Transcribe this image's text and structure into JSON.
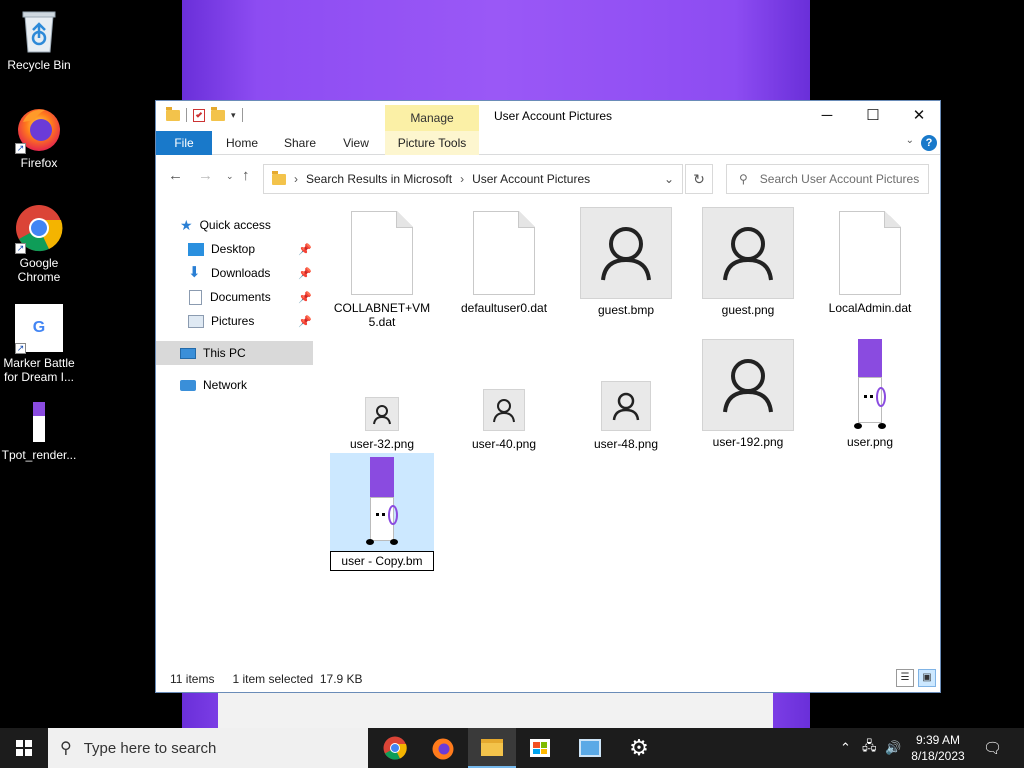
{
  "desktop": {
    "icons": [
      {
        "label": "Recycle Bin"
      },
      {
        "label": "Firefox"
      },
      {
        "label": "Google Chrome"
      },
      {
        "label": "Marker Battle for Dream I..."
      },
      {
        "label": "Tpot_render..."
      }
    ]
  },
  "window": {
    "title": "User Account Pictures",
    "contextual_tab_group": "Manage",
    "ribbon_tabs": [
      "File",
      "Home",
      "Share",
      "View",
      "Picture Tools"
    ],
    "help_label": "?",
    "breadcrumb": [
      "Search Results in Microsoft",
      "User Account Pictures"
    ],
    "search_placeholder": "Search User Account Pictures"
  },
  "nav_pane": {
    "items": [
      {
        "label": "Quick access"
      },
      {
        "label": "Desktop"
      },
      {
        "label": "Downloads"
      },
      {
        "label": "Documents"
      },
      {
        "label": "Pictures"
      },
      {
        "label": "This PC"
      },
      {
        "label": "Network"
      }
    ]
  },
  "files": [
    {
      "name": "COLLABNET+VM\n5.dat"
    },
    {
      "name": "defaultuser0.dat"
    },
    {
      "name": "guest.bmp"
    },
    {
      "name": "guest.png"
    },
    {
      "name": "LocalAdmin.dat"
    },
    {
      "name": "user-32.png"
    },
    {
      "name": "user-40.png"
    },
    {
      "name": "user-48.png"
    },
    {
      "name": "user-192.png"
    },
    {
      "name": "user.png"
    },
    {
      "name": "user - Copy.bm"
    }
  ],
  "status": {
    "item_count": "11 items",
    "selection": "1 item selected  17.9 KB"
  },
  "taskbar": {
    "search_placeholder": "Type here to search",
    "time": "9:39 AM",
    "date": "8/18/2023"
  },
  "colors": {
    "accent": "#1979ca",
    "selection": "#cce8ff",
    "manage_tab": "#fbf0a6",
    "wallpaper_purple": "#9a58f6",
    "marker_purple": "#8a4be0"
  }
}
